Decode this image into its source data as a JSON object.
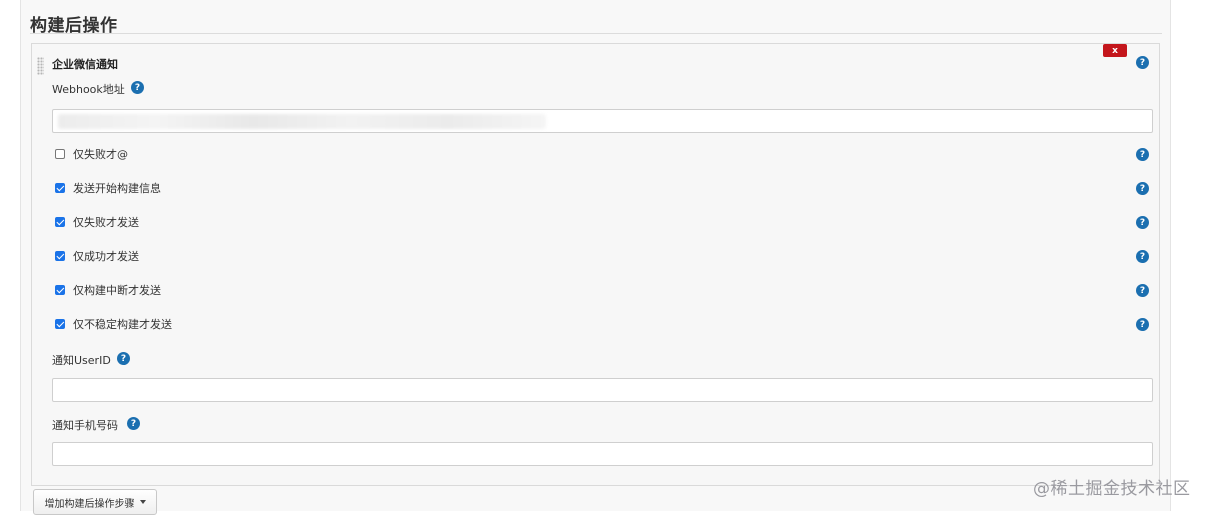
{
  "section": {
    "title": "构建后操作"
  },
  "step": {
    "name": "企业微信通知",
    "delete_label": "x",
    "help_label": "?"
  },
  "fields": {
    "webhook": {
      "label": "Webhook地址",
      "value": ""
    },
    "userid": {
      "label": "通知UserID",
      "value": ""
    },
    "mobile": {
      "label": "通知手机号码",
      "value": ""
    }
  },
  "options": [
    {
      "label": "仅失败才@",
      "checked": false
    },
    {
      "label": "发送开始构建信息",
      "checked": true
    },
    {
      "label": "仅失败才发送",
      "checked": true
    },
    {
      "label": "仅成功才发送",
      "checked": true
    },
    {
      "label": "仅构建中断才发送",
      "checked": true
    },
    {
      "label": "仅不稳定构建才发送",
      "checked": true
    }
  ],
  "add_step_button": {
    "label": "增加构建后操作步骤"
  },
  "watermark": {
    "text": "@稀土掘金技术社区"
  },
  "colors": {
    "help": "#1b6fb0",
    "delete": "#c4161c",
    "checkbox": "#1a73e8"
  }
}
